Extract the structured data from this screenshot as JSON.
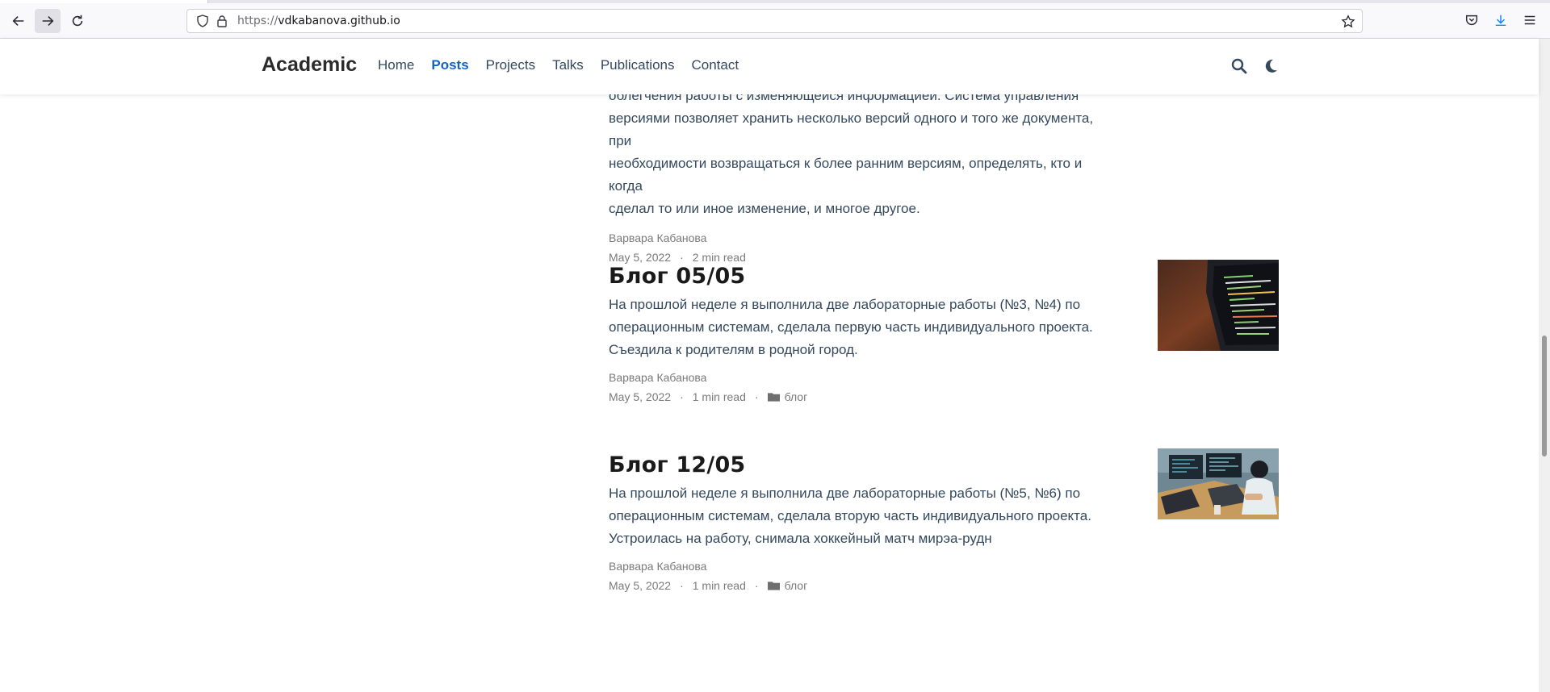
{
  "browser": {
    "url_scheme": "https://",
    "url_host": "vdkabanova.github.io"
  },
  "site": {
    "brand": "Academic",
    "menu": [
      {
        "label": "Home",
        "active": false
      },
      {
        "label": "Posts",
        "active": true
      },
      {
        "label": "Projects",
        "active": false
      },
      {
        "label": "Talks",
        "active": false
      },
      {
        "label": "Publications",
        "active": false
      },
      {
        "label": "Contact",
        "active": false
      }
    ]
  },
  "posts": [
    {
      "summary_lines": [
        "облегчения работы с изменяющейся информацией. Система управления",
        "версиями позволяет хранить несколько версий одного и того же документа, при",
        "необходимости возвращаться к более ранним версиям, определять, кто и когда",
        "сделал то или иное изменение, и многое другое."
      ],
      "author": "Варвара Кабанова",
      "date": "May 5, 2022",
      "read_time": "2 min read"
    },
    {
      "title": "Блог 05/05",
      "summary_lines": [
        "На прошлой неделе я выполнила две лабораторные работы (№3, №4) по",
        "операционным системам, сделала первую часть индивидуального проекта.",
        "Съездила к родителям в родной город."
      ],
      "author": "Варвара Кабанова",
      "date": "May 5, 2022",
      "read_time": "1 min read",
      "category": "блог"
    },
    {
      "title": "Блог 12/05",
      "summary_lines": [
        "На прошлой неделе я выполнила две лабораторные работы (№5, №6) по",
        "операционным системам, сделала вторую часть индивидуального проекта.",
        "Устроилась на работу, снимала хоккейный матч мирэа-рудн"
      ],
      "author": "Варвара Кабанова",
      "date": "May 5, 2022",
      "read_time": "1 min read",
      "category": "блог"
    }
  ],
  "meta_separator": "·",
  "colors": {
    "accent": "#1565c0",
    "nav_text": "#34495e",
    "meta_text": "#7a7a7a"
  }
}
